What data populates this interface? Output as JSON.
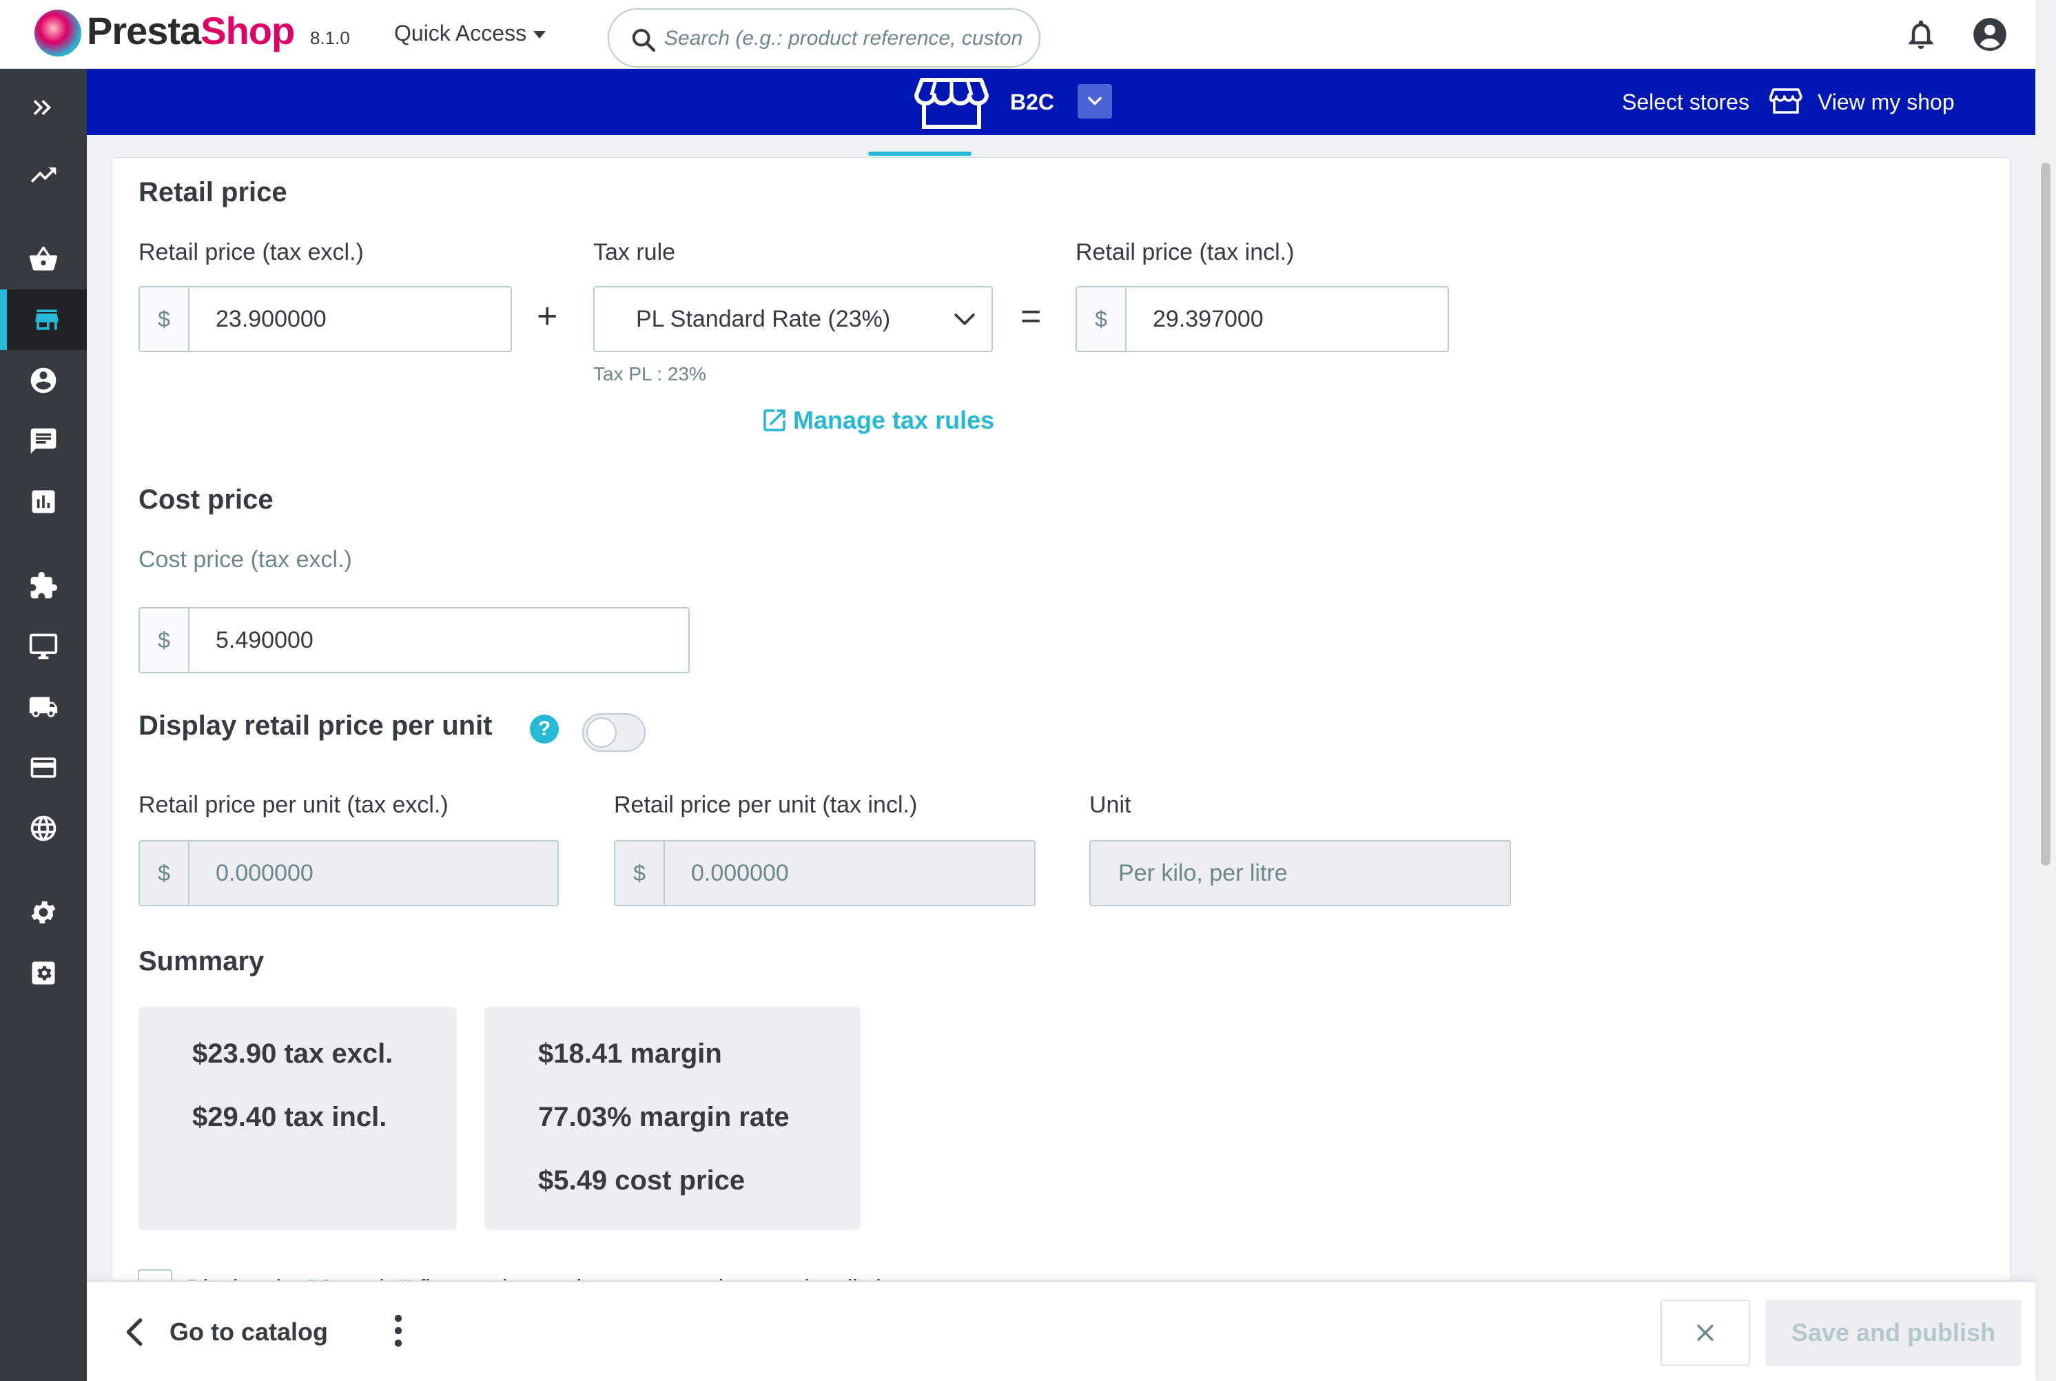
{
  "header": {
    "logo_prefix": "Presta",
    "logo_suffix": "Shop",
    "version": "8.1.0",
    "quick_access": "Quick Access",
    "search_placeholder": "Search (e.g.: product reference, custon"
  },
  "sidebar": {
    "items": [
      {
        "icon": "expand-icon"
      },
      {
        "icon": "trending-up-icon"
      },
      {
        "icon": "shopping-basket-icon"
      },
      {
        "icon": "store-icon",
        "active": true
      },
      {
        "icon": "account-circle-icon"
      },
      {
        "icon": "chat-icon"
      },
      {
        "icon": "bar-chart-icon"
      },
      {
        "icon": "puzzle-icon"
      },
      {
        "icon": "desktop-icon"
      },
      {
        "icon": "truck-icon"
      },
      {
        "icon": "credit-card-icon"
      },
      {
        "icon": "globe-icon"
      },
      {
        "icon": "settings-icon"
      },
      {
        "icon": "advanced-settings-icon"
      }
    ]
  },
  "storebar": {
    "store_name": "B2C",
    "select_stores": "Select stores",
    "view_my_shop": "View my shop",
    "color": "#0017b4"
  },
  "retail": {
    "title": "Retail price",
    "tax_excl_label": "Retail price (tax excl.)",
    "tax_excl_currency": "$",
    "tax_excl_value": "23.900000",
    "plus": "+",
    "tax_rule_label": "Tax rule",
    "tax_rule_value": "PL Standard Rate (23%)",
    "tax_hint": "Tax PL : 23%",
    "equals": "=",
    "tax_incl_label": "Retail price (tax incl.)",
    "tax_incl_currency": "$",
    "tax_incl_value": "29.397000",
    "manage_tax_rules": "Manage tax rules"
  },
  "cost": {
    "title": "Cost price",
    "label": "Cost price (tax excl.)",
    "currency": "$",
    "value": "5.490000"
  },
  "unit_price": {
    "title": "Display retail price per unit",
    "help": "?",
    "toggle_on": false,
    "excl_label": "Retail price per unit (tax excl.)",
    "excl_currency": "$",
    "excl_value": "0.000000",
    "incl_label": "Retail price per unit (tax incl.)",
    "incl_currency": "$",
    "incl_value": "0.000000",
    "unit_label": "Unit",
    "unit_placeholder": "Per kilo, per litre"
  },
  "summary": {
    "title": "Summary",
    "box1": [
      "$23.90 tax excl.",
      "$29.40 tax incl."
    ],
    "box2": [
      "$18.41 margin",
      "77.03% margin rate",
      "$5.49 cost price"
    ]
  },
  "cut_off_text": "Display the \"On sale!\" flag on the product page, and on product listings.",
  "footer": {
    "go_to_catalog": "Go to catalog",
    "save_and_publish": "Save and publish"
  },
  "colors": {
    "accent": "#25b9d7",
    "sidebar": "#363a41",
    "storebar": "#0017b4"
  }
}
